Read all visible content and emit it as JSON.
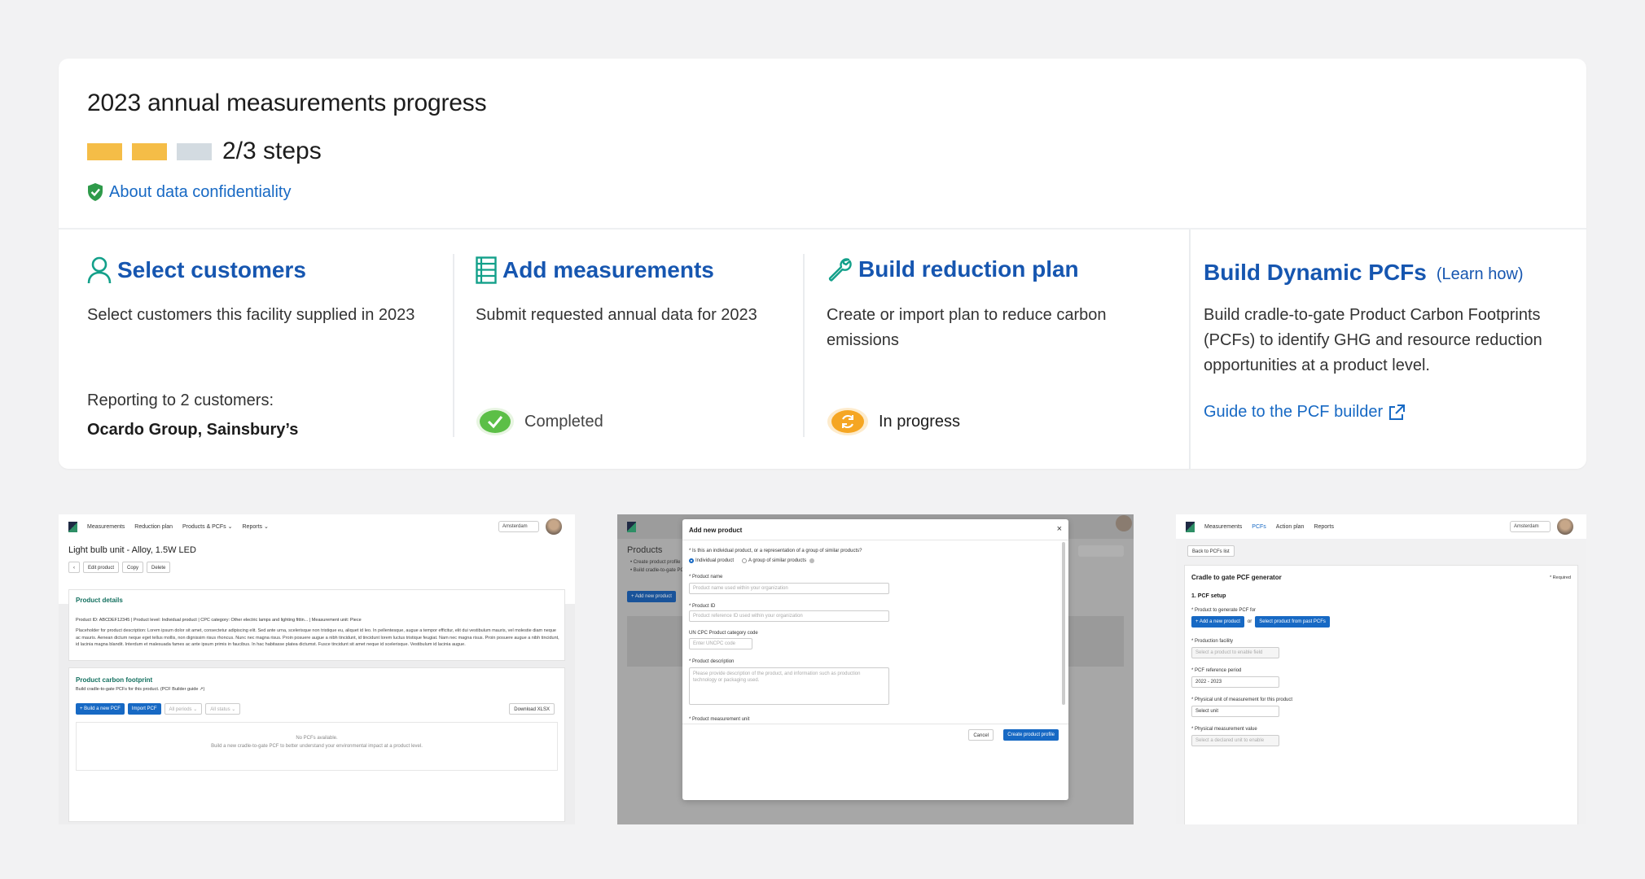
{
  "progress": {
    "title": "2023 annual measurements progress",
    "steps_completed": 2,
    "steps_total": 3,
    "steps_label": "2/3 steps",
    "confidentiality_link": "About data confidentiality"
  },
  "steps": [
    {
      "icon": "user-icon",
      "title": "Select customers",
      "description": "Select customers this facility supplied in 2023",
      "reporting_label": "Reporting to 2 customers:",
      "customers": "Ocardo Group, Sainsbury’s"
    },
    {
      "icon": "list-icon",
      "title": "Add measurements",
      "description": "Submit requested annual data for 2023",
      "status": "Completed"
    },
    {
      "icon": "wrench-icon",
      "title": "Build reduction plan",
      "description": "Create or import plan to reduce carbon emissions",
      "status": "In progress"
    }
  ],
  "pcf": {
    "title": "Build Dynamic PCFs",
    "learn_link": "(Learn how)",
    "description": "Build cradle-to-gate Product Carbon Footprints (PCFs) to identify GHG and resource reduction opportunities at a product level.",
    "guide_link": "Guide to the PCF builder"
  },
  "colors": {
    "accent_blue": "#1656b0",
    "link_blue": "#1769c4",
    "step_done": "#f5bd47",
    "step_todo": "#d3dbe1",
    "completed_green": "#5cbf47",
    "in_progress_orange": "#f5a623",
    "shield_green": "#2e9a4a"
  },
  "screenshot1": {
    "nav": [
      "Measurements",
      "Reduction plan",
      "Products & PCFs ⌄",
      "Reports ⌄"
    ],
    "location": "Amsterdam",
    "title": "Light bulb unit - Alloy, 1.5W LED",
    "actions": [
      "Edit product",
      "Copy",
      "Delete"
    ],
    "details_title": "Product details",
    "meta": "Product ID: ABCDEF12345  |  Product level: Individual product  |  CPC category: Other electric lamps and lighting fittin...  |  Measurement unit: Piece",
    "description": "Placeholder for product description: Lorem ipsum dolor sit amet, consectetur adipiscing elit. Sed ante urna, scelerisque non tristique eu, aliquet id leo. In pellentesque, augue a tempor efficitur, elit dui vestibulum mauris, vel molestie diam neque ac mauris. Aenean dictum neque eget tellus mollis, non dignissim risus rhoncus. Nunc nec magna risus. Proin posuere augue a nibh tincidunt, id tincidunt lorem luctus tristique feugiat. Nam nec magna risus. Proin posuere augue a nibh tincidunt, id lacinia magna blandit. Interdum et malesuada fames ac ante ipsum primis in faucibus. In hac habitasse platea dictumst. Fusce tincidunt sit amet neque id scelerisque. Vestibulum id lacinia augue.",
    "pcf_title": "Product carbon footprint",
    "pcf_sub": "Build cradle-to-gate PCFs for this product. (PCF Builder guide ↗)",
    "buttons": [
      "+ Build a new PCF",
      "Import PCF"
    ],
    "filters": [
      "All periods ⌄",
      "All status ⌄"
    ],
    "download": "Download XLSX",
    "empty_title": "No PCFs available.",
    "empty_sub": "Build a new cradle-to-gate PCF to better understand your environmental impact at a product level."
  },
  "screenshot2": {
    "modal_title": "Add new product",
    "q1": "* Is this an individual product, or a representation of a group of similar products?",
    "radio1": "Individual product",
    "radio2": "A group of similar products",
    "name_label": "* Product name",
    "name_placeholder": "Product name used within your organization",
    "id_label": "* Product ID",
    "id_placeholder": "Product reference ID used within your organization",
    "cpc_label": "UN CPC Product category code",
    "cpc_placeholder": "Enter UNCPC code",
    "desc_label": "* Product description",
    "desc_placeholder": "Please provide description of the product, and information such as production technology or packaging used.",
    "unit_label": "* Product measurement unit",
    "cancel": "Cancel",
    "create": "Create product profile",
    "bg_title": "Products",
    "bg_links": [
      "• Create product profile",
      "• Build cradle-to-gate PCF"
    ],
    "bg_button": "+ Add new product"
  },
  "screenshot3": {
    "nav": [
      "Measurements",
      "PCFs",
      "Action plan",
      "Reports"
    ],
    "location": "Amsterdam",
    "back": "Back to PCFs list",
    "title": "Cradle to gate PCF generator",
    "required": "* Required",
    "section": "1. PCF setup",
    "product_label": "* Product to generate PCF for",
    "add_btn": "+ Add a new product",
    "or": "or",
    "select_btn": "Select product from past PCFs",
    "facility_label": "* Production facility",
    "facility_placeholder": "Select a product to enable field",
    "period_label": "* PCF reference period",
    "period_value": "2022 - 2023",
    "unit_label": "* Physical unit of measurement for this product",
    "unit_value": "Select unit",
    "value_label": "* Physical measurement value",
    "value_placeholder": "Select a declared unit to enable"
  }
}
